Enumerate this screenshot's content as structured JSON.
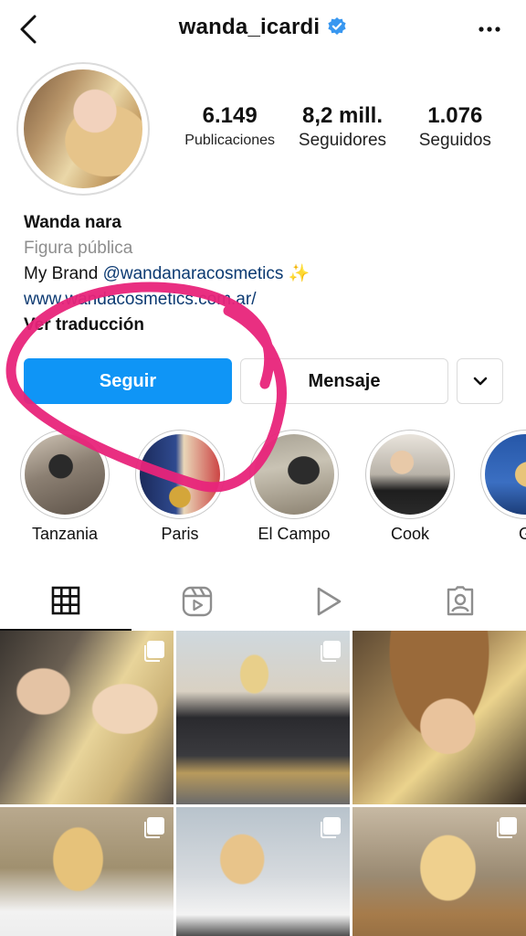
{
  "header": {
    "username": "wanda_icardi",
    "verified_icon": "verified-badge-icon",
    "back_icon": "chevron-left-icon",
    "more_icon": "more-horizontal-icon"
  },
  "stats": [
    {
      "value": "6.149",
      "label": "Publicaciones"
    },
    {
      "value": "8,2 mill.",
      "label": "Seguidores"
    },
    {
      "value": "1.076",
      "label": "Seguidos"
    }
  ],
  "bio": {
    "name": "Wanda nara",
    "category": "Figura pública",
    "line_prefix": "My Brand ",
    "mention": "@wandanaracosmetics",
    "emoji": "✨",
    "website": "www.wandacosmetics.com.ar/",
    "translate": "Ver traducción"
  },
  "buttons": {
    "follow": "Seguir",
    "message": "Mensaje",
    "chevron_icon": "chevron-down-icon"
  },
  "highlights": [
    {
      "label": "Tanzania"
    },
    {
      "label": "Paris"
    },
    {
      "label": "El Campo"
    },
    {
      "label": "Cook"
    },
    {
      "label": "G"
    }
  ],
  "tabs": [
    {
      "icon": "grid-icon",
      "active": true
    },
    {
      "icon": "reels-icon",
      "active": false
    },
    {
      "icon": "video-play-icon",
      "active": false
    },
    {
      "icon": "tagged-user-icon",
      "active": false
    }
  ],
  "colors": {
    "primary_blue": "#0f95f6",
    "link_blue": "#0c3a72",
    "verified_blue": "#3897f0",
    "annotation_pink": "#e8247a",
    "muted_text": "#8e8e8e"
  }
}
